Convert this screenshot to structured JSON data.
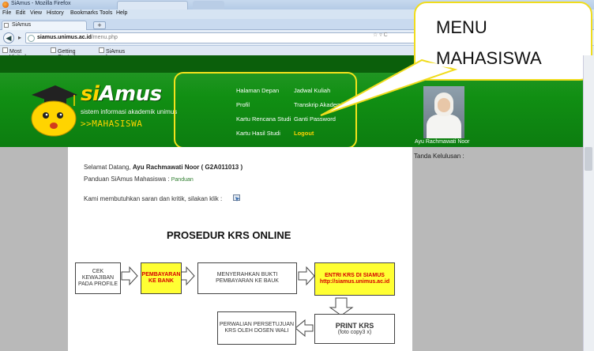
{
  "browser": {
    "window_title": "SiAmus - Mozilla Firefox",
    "menu": [
      "File",
      "Edit",
      "View",
      "History",
      "Bookmarks",
      "Tools",
      "Help"
    ],
    "tab_label": "SiAmus",
    "new_tab": "+",
    "url_domain": "siamus.unimus.ac.id",
    "url_path": "/menu.php",
    "url_right": "☆ ▿ C",
    "bookmarks": [
      "Most Visited",
      "Getting Started",
      "SiAmus | Sistem Infor..."
    ]
  },
  "header": {
    "logo_si": "si",
    "logo_amus": "Amus",
    "tagline": "sistem informasi akademik unimus",
    "role": ">>MAHASISWA",
    "menu_left": [
      "Halaman Depan",
      "Profil",
      "Kartu Rencana Studi",
      "Kartu Hasil Studi"
    ],
    "menu_right": [
      "Jadwal Kuliah",
      "Transkrip Akademik",
      "Ganti Password",
      "Logout"
    ],
    "user_name": "Ayu Rachmawati Noor"
  },
  "content": {
    "welcome_prefix": "Selamat Datang, ",
    "welcome_name": "Ayu Rachmawati Noor ( G2A011013 )",
    "guide_prefix": "Panduan SiAmus Mahasiswa : ",
    "guide_link": "Panduan",
    "feedback": "Kami membutuhkan saran dan kritik, silakan klik :",
    "graduation_label": "Tanda Kelulusan :"
  },
  "callout": {
    "line1": "MENU",
    "line2": "MAHASISWA"
  },
  "flowchart": {
    "title": "PROSEDUR KRS ONLINE",
    "box1": "CEK KEWAJIBAN PADA PROFILE",
    "box2": "PEMBAYARAN KE BANK",
    "box3": "MENYERAHKAN BUKTI PEMBAYARAN KE BAUK",
    "box4_line1": "ENTRI KRS DI SIAMUS",
    "box4_line2": "http://siamus.unimus.ac.id",
    "box5": "PERWALIAN PERSETUJUAN KRS OLEH DOSEN WALI",
    "box6_line1": "PRINT KRS",
    "box6_line2": "(foto copy3 x)"
  },
  "colors": {
    "header_green": "#118f13",
    "accent_yellow": "#ffd400",
    "highlight": "#f3e21c"
  }
}
